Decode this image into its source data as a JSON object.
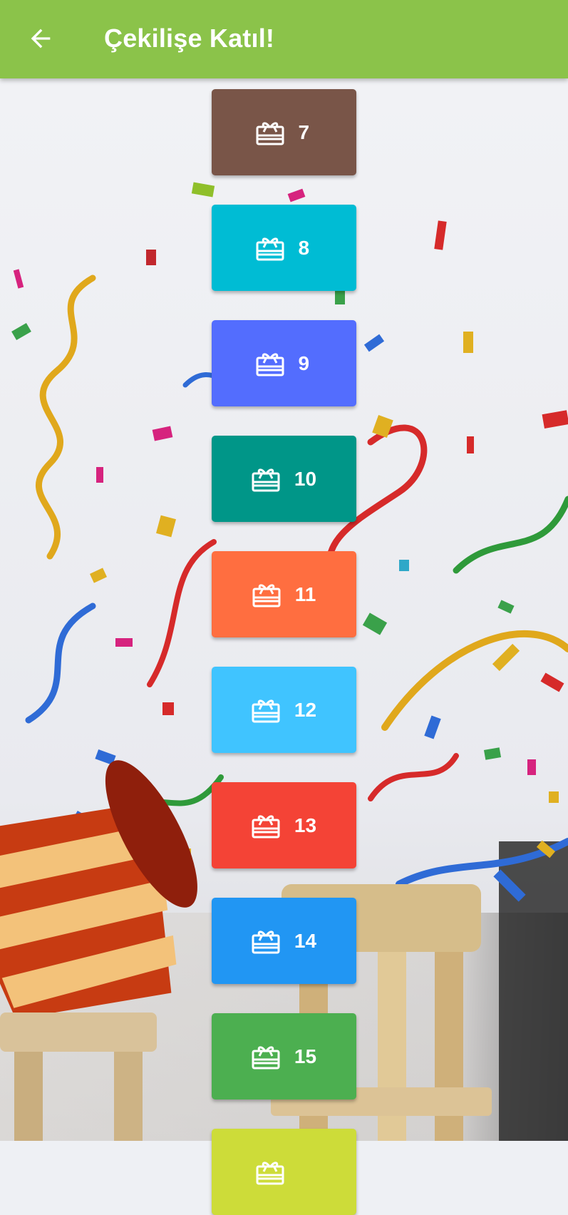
{
  "appbar": {
    "title": "Çekilişe Katıl!",
    "back_icon": "arrow-left-icon",
    "color": "#8bc34a"
  },
  "tickets": [
    {
      "label": "7",
      "color": "#795548",
      "icon": "gift-card-icon"
    },
    {
      "label": "8",
      "color": "#00bcd4",
      "icon": "gift-card-icon"
    },
    {
      "label": "9",
      "color": "#536dfe",
      "icon": "gift-card-icon"
    },
    {
      "label": "10",
      "color": "#009688",
      "icon": "gift-card-icon"
    },
    {
      "label": "11",
      "color": "#ff6e40",
      "icon": "gift-card-icon"
    },
    {
      "label": "12",
      "color": "#40c4ff",
      "icon": "gift-card-icon"
    },
    {
      "label": "13",
      "color": "#f44336",
      "icon": "gift-card-icon"
    },
    {
      "label": "14",
      "color": "#2196f3",
      "icon": "gift-card-icon"
    },
    {
      "label": "15",
      "color": "#4caf50",
      "icon": "gift-card-icon"
    },
    {
      "label": "",
      "color": "#cddc39",
      "icon": "gift-card-icon"
    }
  ]
}
